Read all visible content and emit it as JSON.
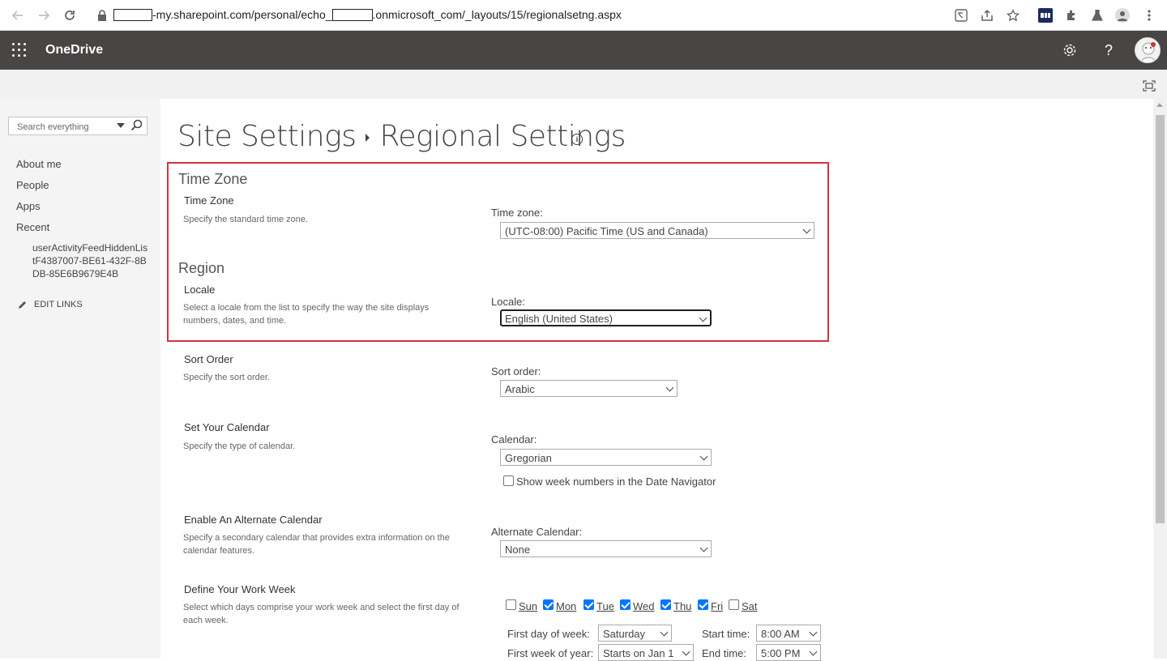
{
  "browser": {
    "url_prefix": "-my.sharepoint.com/personal/echo_",
    "url_mid": ".onmicrosoft_com/_layouts/15/regionalsetng.aspx"
  },
  "suite": {
    "brand": "OneDrive",
    "help_glyph": "?"
  },
  "leftnav": {
    "search_placeholder": "Search everything",
    "items": [
      "About me",
      "People",
      "Apps",
      "Recent"
    ],
    "recent_item": "userActivityFeedHiddenListF4387007-BE61-432F-8BDB-85E6B9679E4B",
    "edit_links": "EDIT LINKS"
  },
  "page": {
    "breadcrumb_parent": "Site Settings",
    "title": "Regional Settings"
  },
  "time_zone": {
    "heading": "Time Zone",
    "title": "Time Zone",
    "description": "Specify the standard time zone.",
    "label": "Time zone:",
    "value": "(UTC-08:00) Pacific Time (US and Canada)"
  },
  "region": {
    "heading": "Region",
    "title": "Locale",
    "description": "Select a locale from the list to specify the way the site displays numbers, dates, and time.",
    "label": "Locale:",
    "value": "English (United States)"
  },
  "sort_order": {
    "title": "Sort Order",
    "description": "Specify the sort order.",
    "label": "Sort order:",
    "value": "Arabic"
  },
  "calendar": {
    "title": "Set Your Calendar",
    "description": "Specify the type of calendar.",
    "label": "Calendar:",
    "value": "Gregorian",
    "week_numbers_label": "Show week numbers in the Date Navigator",
    "week_numbers_checked": false
  },
  "alt_calendar": {
    "title": "Enable An Alternate Calendar",
    "description": "Specify a secondary calendar that provides extra information on the calendar features.",
    "label": "Alternate Calendar:",
    "value": "None"
  },
  "work_week": {
    "title": "Define Your Work Week",
    "description": "Select which days comprise your work week and select the first day of each week.",
    "days": [
      {
        "label": "Sun",
        "checked": false
      },
      {
        "label": "Mon",
        "checked": true
      },
      {
        "label": "Tue",
        "checked": true
      },
      {
        "label": "Wed",
        "checked": true
      },
      {
        "label": "Thu",
        "checked": true
      },
      {
        "label": "Fri",
        "checked": true
      },
      {
        "label": "Sat",
        "checked": false
      }
    ],
    "first_day_label": "First day of week:",
    "first_day_value": "Saturday",
    "first_week_label": "First week of year:",
    "first_week_value": "Starts on Jan 1",
    "start_time_label": "Start time:",
    "start_time_value": "8:00 AM",
    "end_time_label": "End time:",
    "end_time_value": "5:00 PM"
  },
  "colors": {
    "suite_bar": "#484644",
    "highlight": "#d1343e",
    "checkbox": "#0075ff"
  }
}
